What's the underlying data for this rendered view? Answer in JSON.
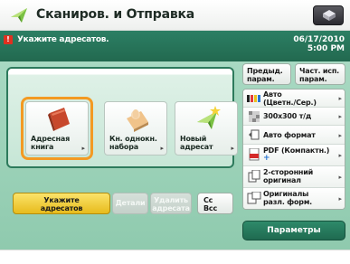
{
  "title": "Сканиров. и Отправка",
  "status": {
    "message": "Укажите адресатов.",
    "date": "06/17/2010",
    "time": "5:00 PM"
  },
  "destinations": {
    "tiles": [
      {
        "line1": "Адресная",
        "line2": "книга"
      },
      {
        "line1": "Кн. однокн.",
        "line2": "набора"
      },
      {
        "line1": "Новый",
        "line2": "адресат"
      }
    ]
  },
  "buttons": {
    "specify_line1": "Укажите",
    "specify_line2": "адресатов",
    "details": "Детали",
    "delete_line1": "Удалить",
    "delete_line2": "адресата",
    "cc_line1": "Cc",
    "cc_line2": "Bcc"
  },
  "right": {
    "previous_line1": "Предыд.",
    "previous_line2": "парам.",
    "frequent_line1": "Част. исп.",
    "frequent_line2": "парам.",
    "settings": [
      {
        "line1": "Авто",
        "line2": "(Цветн./Сер.)"
      },
      {
        "line1": "300x300 т/д",
        "line2": ""
      },
      {
        "line1": "Авто формат",
        "line2": ""
      },
      {
        "line1": "PDF (Компактн.)",
        "line2": ""
      },
      {
        "line1": "2-сторонний",
        "line2": "оригинал"
      },
      {
        "line1": "Оригиналы",
        "line2": "разл. форм."
      }
    ],
    "params": "Параметры"
  },
  "colors": {
    "status_green": "#22694f",
    "main_green": "#a8d9c2",
    "selected_orange": "#f39a23",
    "specify_yellow": "#e7bb1c"
  }
}
